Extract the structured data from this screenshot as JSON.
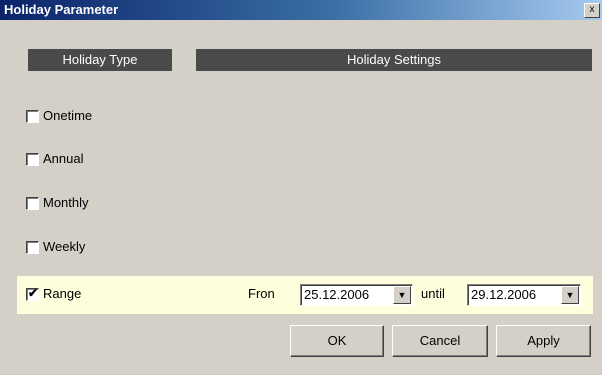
{
  "window": {
    "title": "Holiday Parameter",
    "close_label": "x"
  },
  "headers": {
    "type": "Holiday Type",
    "settings": "Holiday Settings"
  },
  "options": [
    {
      "label": "Onetime",
      "checked": false
    },
    {
      "label": "Annual",
      "checked": false
    },
    {
      "label": "Monthly",
      "checked": false
    },
    {
      "label": "Weekly",
      "checked": false
    },
    {
      "label": "Range",
      "checked": true
    }
  ],
  "range": {
    "checkmark": "✔",
    "from_label": "Fron",
    "from_value": "25.12.2006",
    "until_label": "until",
    "until_value": "29.12.2006",
    "dropdown_glyph": "▼"
  },
  "buttons": {
    "ok": "OK",
    "cancel": "Cancel",
    "apply": "Apply"
  },
  "colors": {
    "titlebar": "#0a246a",
    "header_bg": "#4a4a4a",
    "highlight_row": "#fffedc",
    "window_bg": "#d4d0c8"
  }
}
